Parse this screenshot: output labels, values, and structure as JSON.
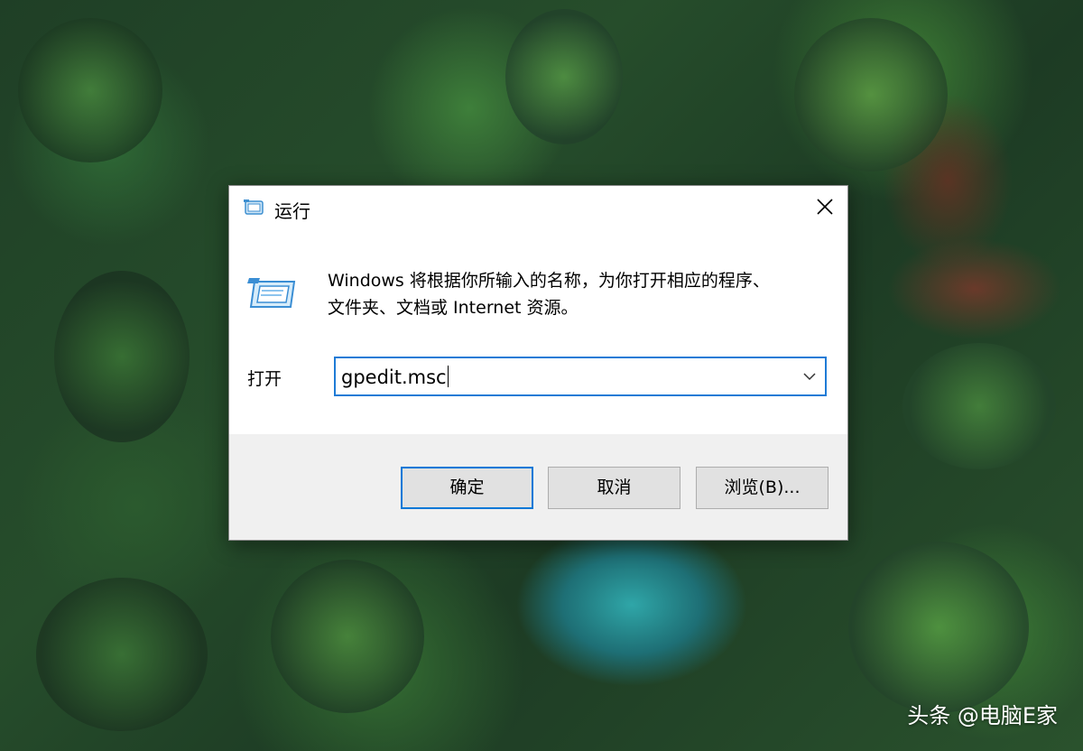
{
  "dialog": {
    "title": "运行",
    "description_line1": "Windows 将根据你所输入的名称，为你打开相应的程序、",
    "description_line2": "文件夹、文档或 Internet 资源。",
    "open_label": "打开",
    "open_value": "gpedit.msc",
    "buttons": {
      "ok": "确定",
      "cancel": "取消",
      "browse": "浏览(B)..."
    },
    "icons": {
      "title": "run-icon",
      "main": "run-icon",
      "close": "close-icon",
      "dropdown": "chevron-down-icon"
    }
  },
  "watermark": {
    "text": "头条 @电脑E家"
  },
  "colors": {
    "focus_blue": "#0078d7",
    "dialog_bg": "#f0f0f0",
    "button_bg": "#e1e1e1"
  }
}
